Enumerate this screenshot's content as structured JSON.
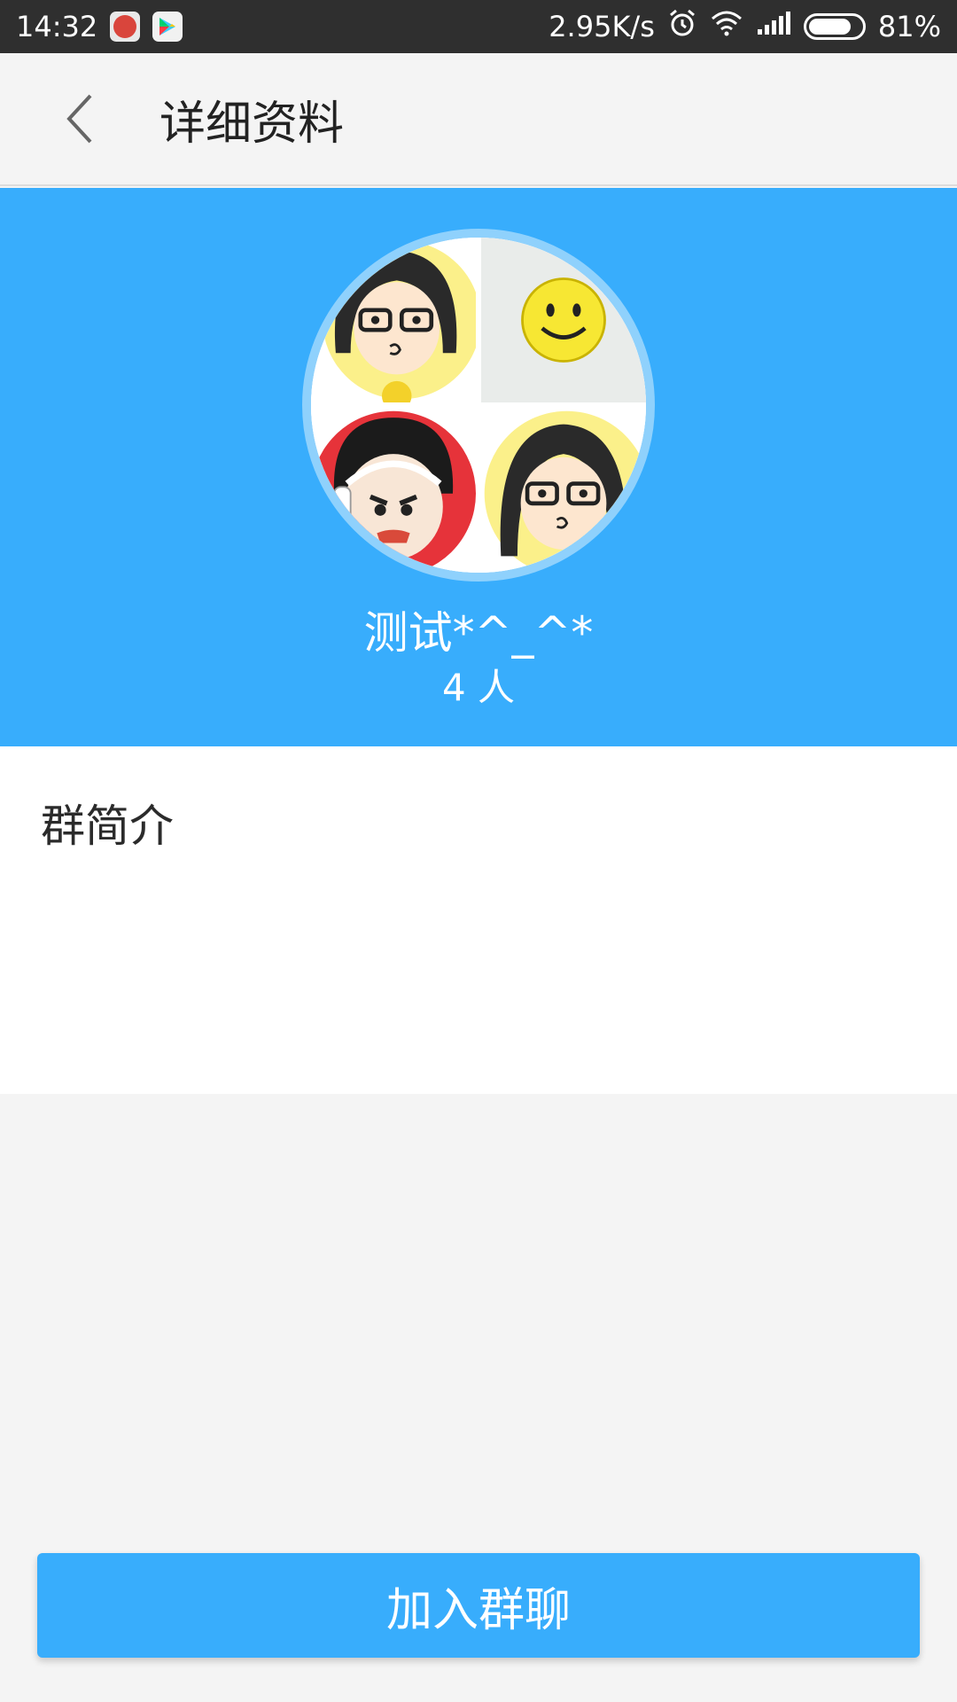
{
  "status_bar": {
    "time": "14:32",
    "network_speed": "2.95K/s",
    "battery_percent": "81%",
    "battery_level": 0.81,
    "icons": [
      "red-app-icon",
      "play-store-icon",
      "alarm-icon",
      "wifi-icon",
      "signal-icon",
      "battery-icon"
    ]
  },
  "app_bar": {
    "title": "详细资料",
    "back_icon": "chevron-left-icon"
  },
  "group": {
    "name": "测试*^_^*",
    "member_count": "4 人",
    "avatar_tiles": [
      "cartoon-girl-glasses",
      "smiley-face",
      "cartoon-boy-headphones",
      "cartoon-girl-glasses"
    ]
  },
  "intro": {
    "label": "群简介"
  },
  "actions": {
    "join_label": "加入群聊"
  },
  "colors": {
    "accent": "#38adfc",
    "status_bar": "#2f2f2f",
    "background": "#f4f4f4"
  }
}
